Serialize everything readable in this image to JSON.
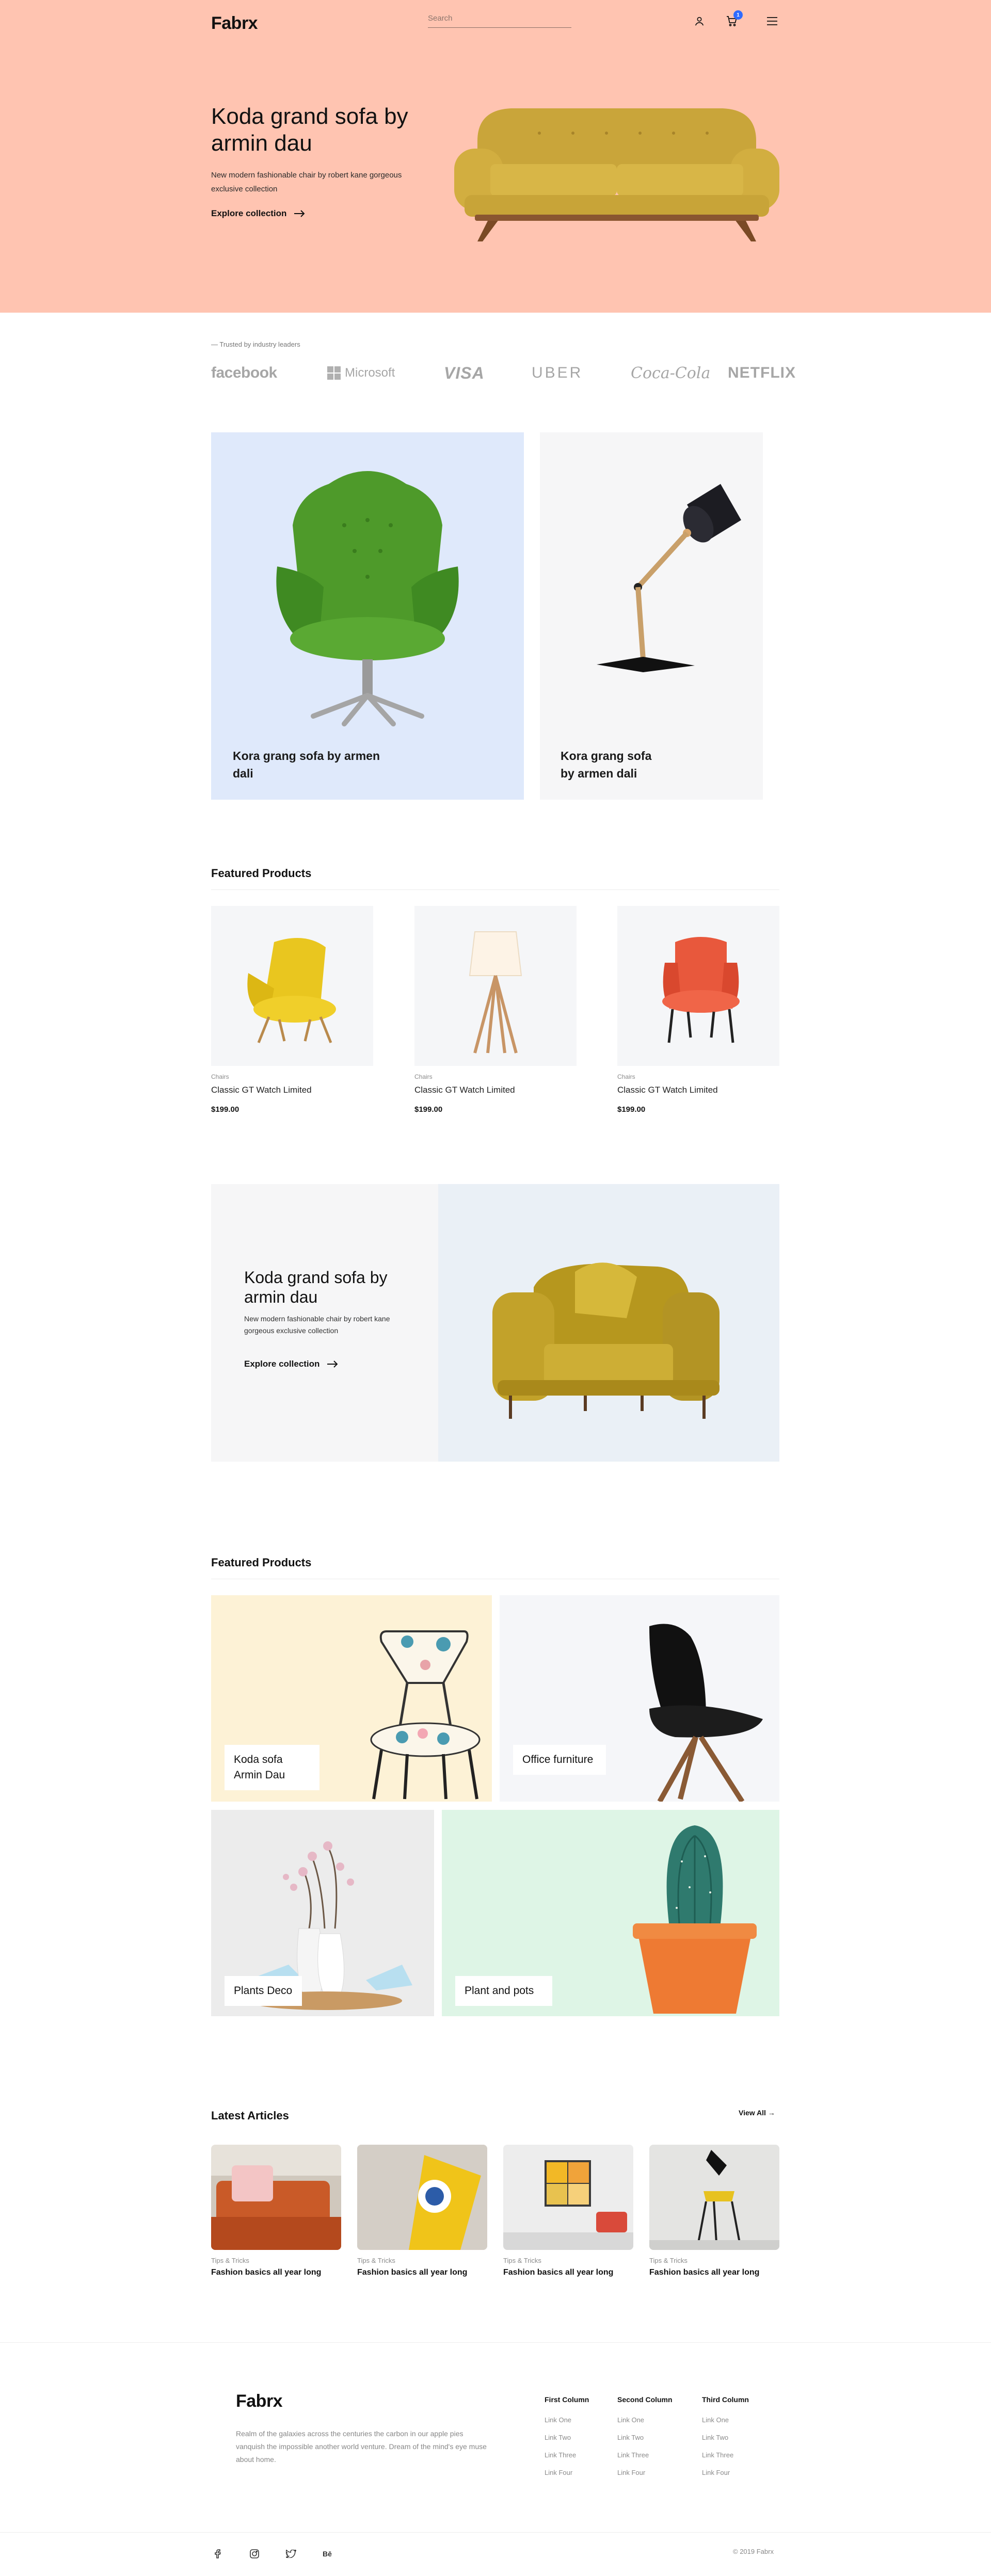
{
  "header": {
    "logo": "Fabrx",
    "search_placeholder": "Search",
    "cart_count": "1"
  },
  "hero": {
    "title": "Koda grand sofa by armin dau",
    "description": "New modern fashionable chair by robert kane gorgeous exclusive collection",
    "cta": "Explore collection",
    "background": "#ffc4b1"
  },
  "trusted": {
    "label": "— Trusted by industry leaders",
    "brands": [
      "facebook",
      "Microsoft",
      "VISA",
      "UBER",
      "Coca-Cola",
      "NETFLIX"
    ]
  },
  "promos": [
    {
      "title": "Kora grang sofa by armen dali"
    },
    {
      "title": "Kora grang sofa by armen dali"
    }
  ],
  "featured_1": {
    "title": "Featured Products",
    "products": [
      {
        "category": "Chairs",
        "name": "Classic GT Watch Limited",
        "price": "$199.00"
      },
      {
        "category": "Chairs",
        "name": "Classic GT Watch Limited",
        "price": "$199.00"
      },
      {
        "category": "Chairs",
        "name": "Classic GT Watch Limited",
        "price": "$199.00"
      }
    ]
  },
  "banner": {
    "title": "Koda grand sofa by armin dau",
    "description": "New modern fashionable chair by robert kane gorgeous exclusive collection",
    "cta": "Explore collection"
  },
  "featured_2": {
    "title": "Featured Products",
    "tiles": [
      {
        "label": "Koda sofa Armin Dau"
      },
      {
        "label": "Office furniture"
      },
      {
        "label": "Plants Deco"
      },
      {
        "label": "Plant and pots"
      }
    ]
  },
  "articles": {
    "title": "Latest Articles",
    "view_all": "View All →",
    "items": [
      {
        "tag": "Tips & Tricks",
        "title": "Fashion basics all year long"
      },
      {
        "tag": "Tips & Tricks",
        "title": "Fashion basics all year long"
      },
      {
        "tag": "Tips & Tricks",
        "title": "Fashion basics all year long"
      },
      {
        "tag": "Tips & Tricks",
        "title": "Fashion basics all year long"
      }
    ]
  },
  "footer": {
    "logo": "Fabrx",
    "description": "Realm of the galaxies across the centuries the carbon in our apple pies vanquish the impossible another world venture. Dream of the mind's eye muse about home.",
    "columns": [
      {
        "title": "First Column",
        "links": [
          "Link One",
          "Link Two",
          "Link Three",
          "Link Four"
        ]
      },
      {
        "title": "Second Column",
        "links": [
          "Link One",
          "Link Two",
          "Link Three",
          "Link Four"
        ]
      },
      {
        "title": "Third Column",
        "links": [
          "Link One",
          "Link Two",
          "Link Three",
          "Link Four"
        ]
      }
    ],
    "social": [
      "facebook-icon",
      "instagram-icon",
      "twitter-icon",
      "behance-icon"
    ],
    "behance_text": "Bē",
    "copyright": "© 2019 Fabrx"
  }
}
